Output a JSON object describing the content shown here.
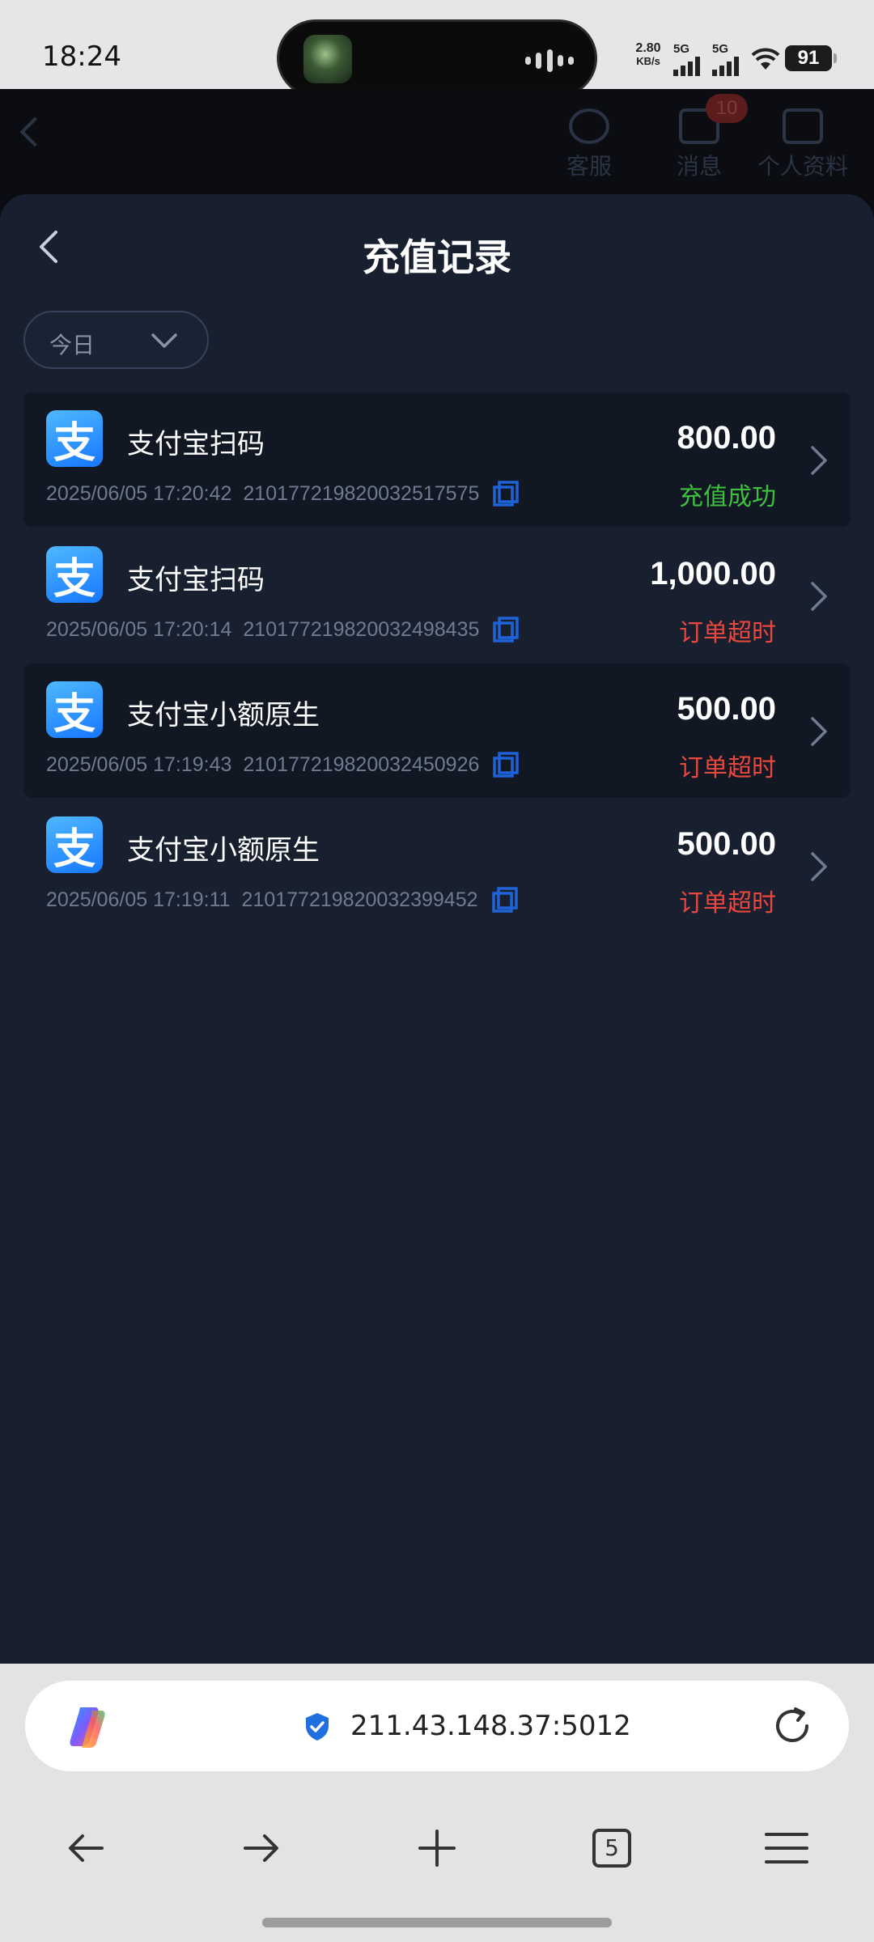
{
  "status_bar": {
    "time": "18:24",
    "net_speed": "2.80",
    "net_unit": "KB/s",
    "sim1": "5G",
    "sim2": "5G",
    "battery": "91"
  },
  "background_page": {
    "service_label": "客服",
    "messages_label": "消息",
    "messages_badge": "10",
    "profile_label": "个人资料"
  },
  "sheet": {
    "title": "充值记录",
    "filter_value": "今日"
  },
  "records": [
    {
      "icon_glyph": "支",
      "method": "支付宝扫码",
      "datetime": "2025/06/05 17:20:42",
      "order_no": "210177219820032517575",
      "amount": "800.00",
      "status": "充值成功",
      "status_color": "#3fbf3f"
    },
    {
      "icon_glyph": "支",
      "method": "支付宝扫码",
      "datetime": "2025/06/05 17:20:14",
      "order_no": "210177219820032498435",
      "amount": "1,000.00",
      "status": "订单超时",
      "status_color": "#e8483e"
    },
    {
      "icon_glyph": "支",
      "method": "支付宝小额原生",
      "datetime": "2025/06/05 17:19:43",
      "order_no": "210177219820032450926",
      "amount": "500.00",
      "status": "订单超时",
      "status_color": "#e8483e"
    },
    {
      "icon_glyph": "支",
      "method": "支付宝小额原生",
      "datetime": "2025/06/05 17:19:11",
      "order_no": "210177219820032399452",
      "amount": "500.00",
      "status": "订单超时",
      "status_color": "#e8483e"
    }
  ],
  "browser": {
    "url": "211.43.148.37:5012",
    "tab_count": "5"
  },
  "colors": {
    "sheet_bg": "#182030",
    "alt_row_bg": "#111723",
    "accent_blue": "#1677ff",
    "success": "#3fbf3f",
    "timeout": "#e8483e"
  }
}
